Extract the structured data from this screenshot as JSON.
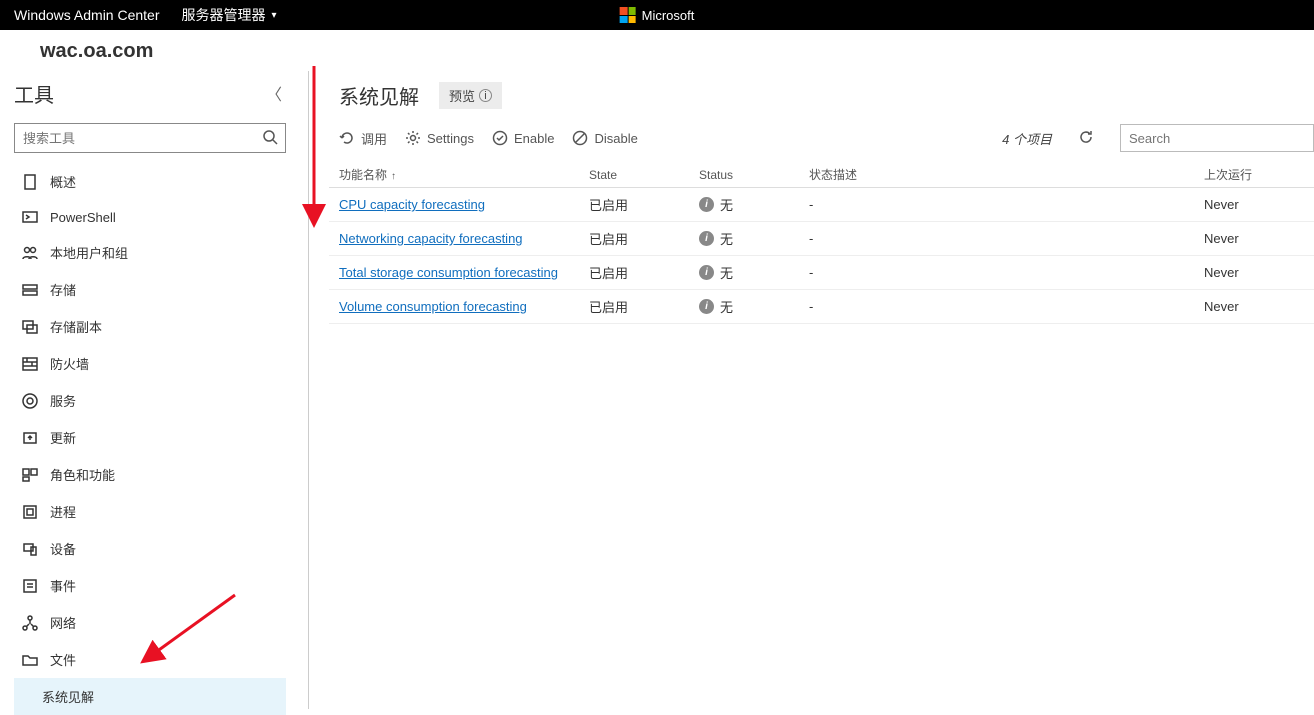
{
  "topbar": {
    "app": "Windows Admin Center",
    "breadcrumb": "服务器管理器",
    "brand": "Microsoft"
  },
  "server": {
    "name": "wac.oa.com"
  },
  "sidebar": {
    "title": "工具",
    "search_placeholder": "搜索工具",
    "items": [
      {
        "id": "overview",
        "label": "概述"
      },
      {
        "id": "powershell",
        "label": "PowerShell"
      },
      {
        "id": "local-users",
        "label": "本地用户和组"
      },
      {
        "id": "storage",
        "label": "存储"
      },
      {
        "id": "storage-replica",
        "label": "存储副本"
      },
      {
        "id": "firewall",
        "label": "防火墙"
      },
      {
        "id": "services",
        "label": "服务"
      },
      {
        "id": "updates",
        "label": "更新"
      },
      {
        "id": "roles-features",
        "label": "角色和功能"
      },
      {
        "id": "processes",
        "label": "进程"
      },
      {
        "id": "devices",
        "label": "设备"
      },
      {
        "id": "events",
        "label": "事件"
      },
      {
        "id": "network",
        "label": "网络"
      },
      {
        "id": "files",
        "label": "文件"
      },
      {
        "id": "system-insights",
        "label": "系统见解"
      }
    ]
  },
  "main": {
    "title": "系统见解",
    "preview": "预览",
    "commands": {
      "invoke": "调用",
      "settings": "Settings",
      "enable": "Enable",
      "disable": "Disable"
    },
    "item_count": "4 个项目",
    "search_placeholder": "Search",
    "columns": {
      "name": "功能名称",
      "state": "State",
      "status": "Status",
      "desc": "状态描述",
      "last": "上次运行"
    },
    "rows": [
      {
        "name": "CPU capacity forecasting",
        "state": "已启用",
        "status": "无",
        "desc": "-",
        "last": "Never"
      },
      {
        "name": "Networking capacity forecasting",
        "state": "已启用",
        "status": "无",
        "desc": "-",
        "last": "Never"
      },
      {
        "name": "Total storage consumption forecasting",
        "state": "已启用",
        "status": "无",
        "desc": "-",
        "last": "Never"
      },
      {
        "name": "Volume consumption forecasting",
        "state": "已启用",
        "status": "无",
        "desc": "-",
        "last": "Never"
      }
    ]
  }
}
